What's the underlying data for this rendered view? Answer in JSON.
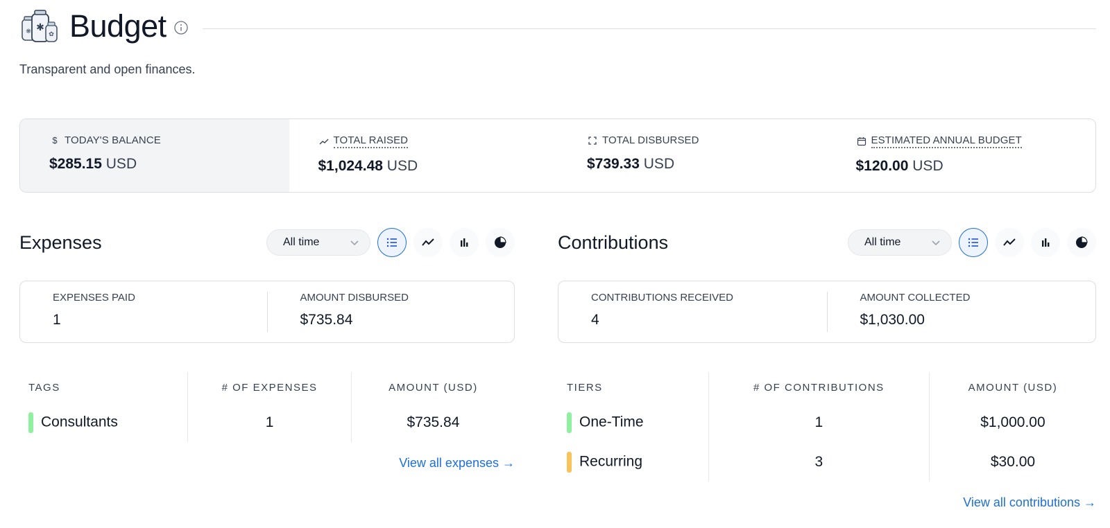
{
  "header": {
    "title": "Budget",
    "icon": "jars-illustration-icon",
    "info_icon": "info-icon"
  },
  "subtitle": "Transparent and open finances.",
  "summary": {
    "todays_balance": {
      "label": "TODAY'S BALANCE",
      "icon": "dollar-icon",
      "amount": "$285.15",
      "currency": "USD"
    },
    "total_raised": {
      "label": "TOTAL RAISED",
      "icon": "trend-up-icon",
      "amount": "$1,024.48",
      "currency": "USD"
    },
    "total_disbursed": {
      "label": "TOTAL DISBURSED",
      "icon": "expand-icon",
      "amount": "$739.33",
      "currency": "USD"
    },
    "estimated_annual_budget": {
      "label": "ESTIMATED ANNUAL BUDGET",
      "icon": "calendar-icon",
      "amount": "$120.00",
      "currency": "USD"
    }
  },
  "expenses": {
    "title": "Expenses",
    "period": "All time",
    "metrics": {
      "paid_label": "EXPENSES PAID",
      "paid_value": "1",
      "disbursed_label": "AMOUNT DISBURSED",
      "disbursed_value": "$735.84"
    },
    "table": {
      "headers": [
        "TAGS",
        "# OF EXPENSES",
        "AMOUNT (USD)"
      ],
      "rows": [
        {
          "name": "Consultants",
          "color": "#8ff0a0",
          "count": "1",
          "amount": "$735.84"
        }
      ]
    },
    "view_all": "View all expenses →"
  },
  "contributions": {
    "title": "Contributions",
    "period": "All time",
    "metrics": {
      "received_label": "CONTRIBUTIONS RECEIVED",
      "received_value": "4",
      "collected_label": "AMOUNT COLLECTED",
      "collected_value": "$1,030.00"
    },
    "table": {
      "headers": [
        "TIERS",
        "# OF CONTRIBUTIONS",
        "AMOUNT (USD)"
      ],
      "rows": [
        {
          "name": "One-Time",
          "color": "#8ff0a0",
          "count": "1",
          "amount": "$1,000.00"
        },
        {
          "name": "Recurring",
          "color": "#f9c35c",
          "count": "3",
          "amount": "$30.00"
        }
      ]
    },
    "view_all": "View all contributions →"
  },
  "view_modes": [
    "list-view-icon",
    "line-chart-icon",
    "bar-chart-icon",
    "pie-chart-icon"
  ],
  "colors": {
    "accent": "#1d6fd8",
    "border": "#dcdee3",
    "balance_bg": "#f3f4f6"
  }
}
